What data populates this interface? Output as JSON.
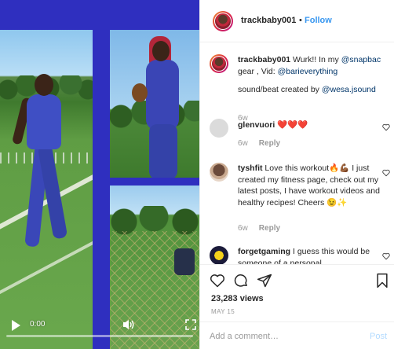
{
  "video": {
    "time": "0:00",
    "progress": 0
  },
  "header": {
    "username": "trackbaby001",
    "separator": "•",
    "follow_label": "Follow"
  },
  "caption": {
    "username": "trackbaby001",
    "text": " Wurk!! In my ",
    "mention1": "@snapbac",
    "text2": " gear , Vid: ",
    "mention2": "@barieverything",
    "line2_text": "sound/beat created by ",
    "mention3": "@wesa.jsound",
    "age": "6w"
  },
  "comments": [
    {
      "username": "glenvuori",
      "text": " ❤️❤️❤️",
      "age": "6w",
      "reply": "Reply"
    },
    {
      "username": "tyshfit",
      "text": " Love this workout🔥💪🏾 I just created my fitness page, check out my latest posts, I have workout videos and healthy recipes! Cheers 😉✨",
      "age": "6w",
      "reply": "Reply"
    },
    {
      "username": "forgetgaming",
      "text": " I guess this would be someone of a personal"
    }
  ],
  "stats": {
    "views": "23,283 views",
    "date": "MAY 15"
  },
  "add_comment": {
    "placeholder": "Add a comment…",
    "post_label": "Post"
  },
  "icons": {
    "like": "heart-icon",
    "comment": "comment-icon",
    "share": "share-icon",
    "save": "bookmark-icon",
    "play": "play-icon",
    "mute": "volume-icon",
    "fullscreen": "fullscreen-icon"
  },
  "colors": {
    "accent": "#3897f0",
    "mention": "#003569",
    "muted": "#999999",
    "post_disabled": "#b3dbff",
    "video_bg": "#2f2fbf"
  }
}
